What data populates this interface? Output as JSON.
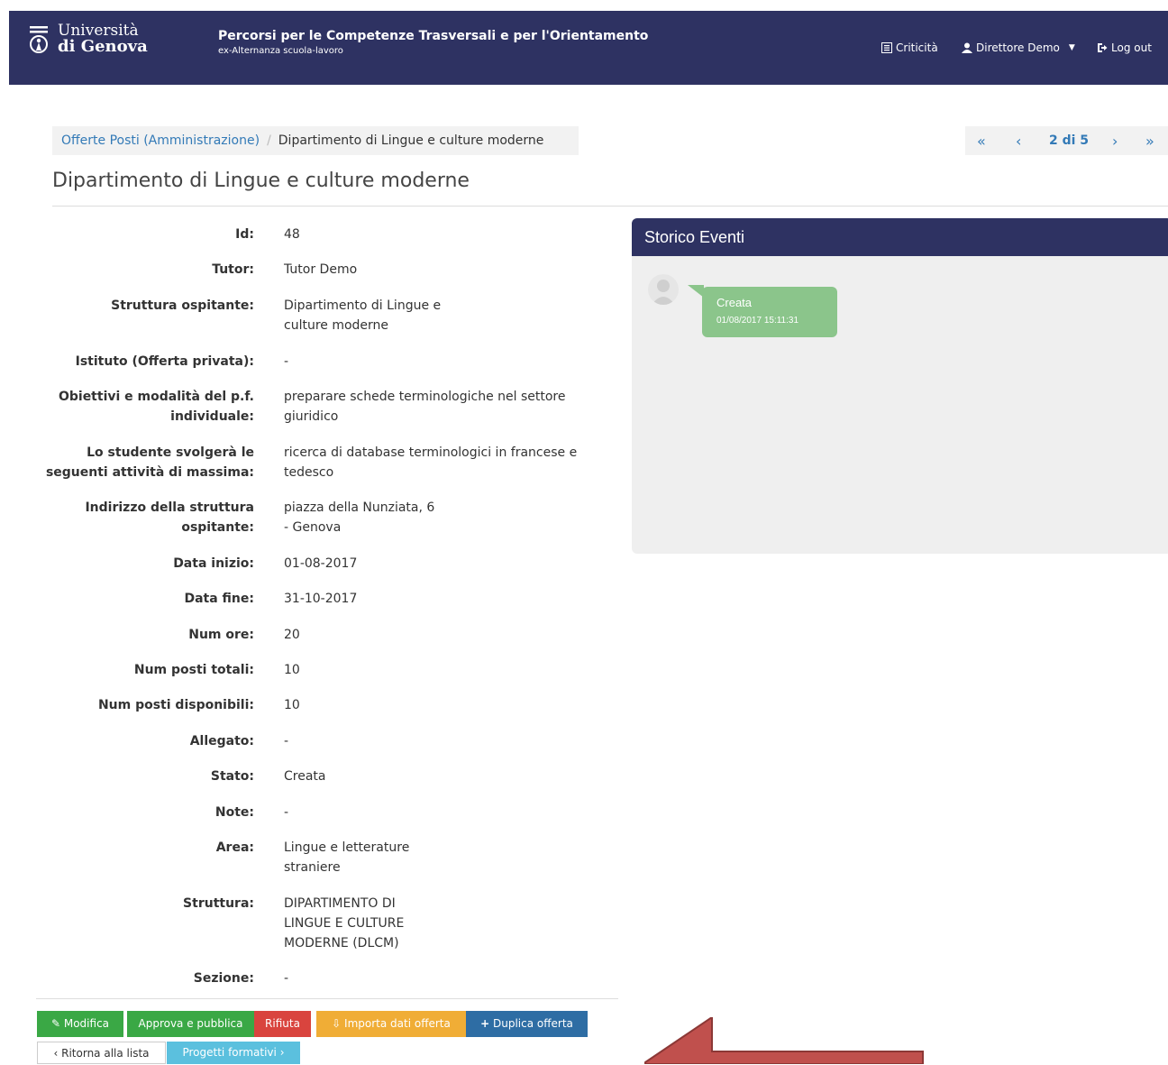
{
  "header": {
    "logo_line1": "Università",
    "logo_line2": "di Genova",
    "title": "Percorsi per le Competenze Trasversali e per l'Orientamento",
    "subtitle": "ex-Alternanza scuola-lavoro",
    "nav": {
      "criticita": "Criticità",
      "user": "Direttore Demo",
      "logout": "Log out"
    }
  },
  "breadcrumb": {
    "parent": "Offerte Posti (Amministrazione)",
    "current": "Dipartimento di Lingue e culture moderne"
  },
  "pager": {
    "first": "«",
    "prev": "‹",
    "position": "2 di 5",
    "next": "›",
    "last": "»"
  },
  "page_title": "Dipartimento di Lingue e culture moderne",
  "fields": {
    "id": {
      "label": "Id:",
      "value": "48"
    },
    "tutor": {
      "label": "Tutor:",
      "value": "Tutor Demo"
    },
    "struttura_ospitante": {
      "label": "Struttura ospitante:",
      "value": "Dipartimento di Lingue e\nculture moderne"
    },
    "istituto": {
      "label": "Istituto (Offerta privata):",
      "value": "-"
    },
    "obiettivi": {
      "label": "Obiettivi e modalità del p.f.\nindividuale:",
      "value": "preparare schede terminologiche nel settore\ngiuridico"
    },
    "attivita": {
      "label": "Lo studente svolgerà le\nseguenti attività di massima:",
      "value": "ricerca di database terminologici in francese e\ntedesco"
    },
    "indirizzo": {
      "label": "Indirizzo della struttura\nospitante:",
      "value": "piazza della Nunziata, 6\n- Genova"
    },
    "data_inizio": {
      "label": "Data inizio:",
      "value": "01-08-2017"
    },
    "data_fine": {
      "label": "Data fine:",
      "value": "31-10-2017"
    },
    "num_ore": {
      "label": "Num ore:",
      "value": "20"
    },
    "num_posti_totali": {
      "label": "Num posti totali:",
      "value": "10"
    },
    "num_posti_disponibili": {
      "label": "Num posti disponibili:",
      "value": "10"
    },
    "allegato": {
      "label": "Allegato:",
      "value": "-"
    },
    "stato": {
      "label": "Stato:",
      "value": "Creata"
    },
    "note": {
      "label": "Note:",
      "value": "-"
    },
    "area": {
      "label": "Area:",
      "value": "Lingue e letterature\nstraniere"
    },
    "struttura": {
      "label": "Struttura:",
      "value": "DIPARTIMENTO DI\nLINGUE E CULTURE\nMODERNE (DLCM)"
    },
    "sezione": {
      "label": "Sezione:",
      "value": "-"
    }
  },
  "storico": {
    "title": "Storico Eventi",
    "event_label": "Creata",
    "event_time": "01/08/2017 15:11:31"
  },
  "buttons": {
    "modifica": "Modifica",
    "approva": "Approva e pubblica",
    "rifiuta": "Rifiuta",
    "importa": "Importa dati offerta",
    "duplica": "Duplica offerta",
    "ritorna": "Ritorna alla lista",
    "progetti": "Progetti formativi"
  },
  "colors": {
    "header_bg": "#2e3262",
    "link": "#337ab7",
    "green": "#3aa845",
    "red": "#d9443e",
    "orange": "#f0ad36",
    "blue": "#2e6da4",
    "info": "#5bc0de",
    "arrow": "#c0504d"
  }
}
